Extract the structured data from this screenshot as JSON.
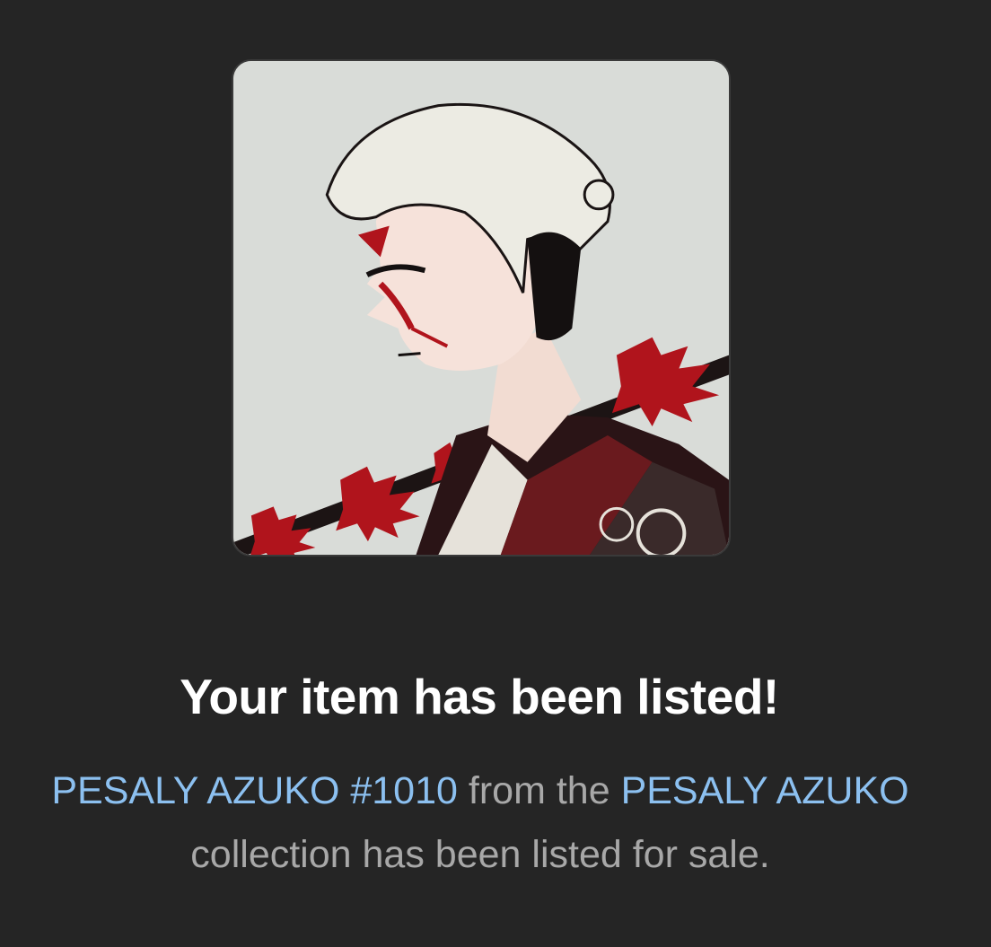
{
  "listing": {
    "image_alt": "PESALY AZUKO #1010",
    "title": "Your item has been listed!",
    "item_name": "PESALY AZUKO #1010",
    "from_text": " from the ",
    "collection_name": "PESALY AZUKO",
    "suffix_text": " collection has been listed for sale."
  },
  "colors": {
    "background": "#252525",
    "link": "#8cc0f0",
    "muted_text": "#a8a8a8",
    "title_text": "#ffffff",
    "art_accent": "#b0141c"
  }
}
